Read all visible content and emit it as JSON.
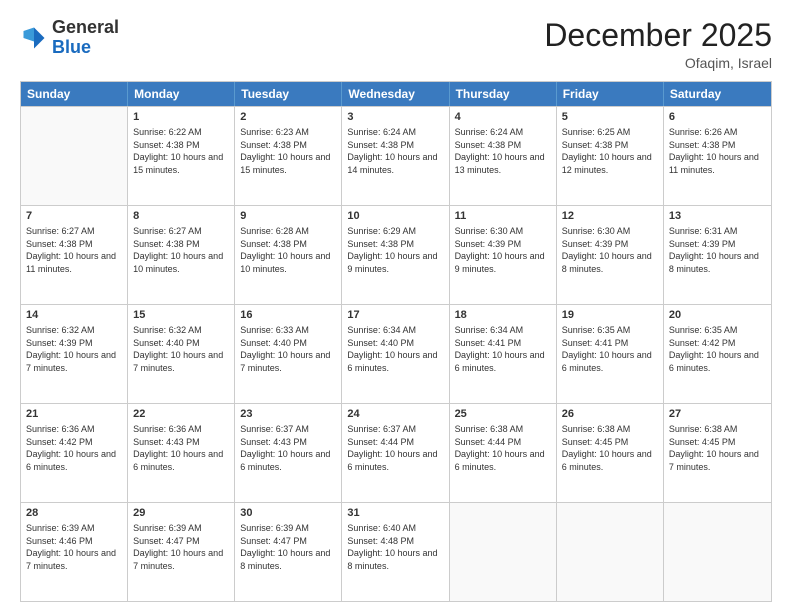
{
  "header": {
    "logo_general": "General",
    "logo_blue": "Blue",
    "month_year": "December 2025",
    "location": "Ofaqim, Israel"
  },
  "days_of_week": [
    "Sunday",
    "Monday",
    "Tuesday",
    "Wednesday",
    "Thursday",
    "Friday",
    "Saturday"
  ],
  "weeks": [
    [
      {
        "day": "",
        "empty": true
      },
      {
        "day": "1",
        "sunrise": "6:22 AM",
        "sunset": "4:38 PM",
        "daylight": "10 hours and 15 minutes."
      },
      {
        "day": "2",
        "sunrise": "6:23 AM",
        "sunset": "4:38 PM",
        "daylight": "10 hours and 15 minutes."
      },
      {
        "day": "3",
        "sunrise": "6:24 AM",
        "sunset": "4:38 PM",
        "daylight": "10 hours and 14 minutes."
      },
      {
        "day": "4",
        "sunrise": "6:24 AM",
        "sunset": "4:38 PM",
        "daylight": "10 hours and 13 minutes."
      },
      {
        "day": "5",
        "sunrise": "6:25 AM",
        "sunset": "4:38 PM",
        "daylight": "10 hours and 12 minutes."
      },
      {
        "day": "6",
        "sunrise": "6:26 AM",
        "sunset": "4:38 PM",
        "daylight": "10 hours and 11 minutes."
      }
    ],
    [
      {
        "day": "7",
        "sunrise": "6:27 AM",
        "sunset": "4:38 PM",
        "daylight": "10 hours and 11 minutes."
      },
      {
        "day": "8",
        "sunrise": "6:27 AM",
        "sunset": "4:38 PM",
        "daylight": "10 hours and 10 minutes."
      },
      {
        "day": "9",
        "sunrise": "6:28 AM",
        "sunset": "4:38 PM",
        "daylight": "10 hours and 10 minutes."
      },
      {
        "day": "10",
        "sunrise": "6:29 AM",
        "sunset": "4:38 PM",
        "daylight": "10 hours and 9 minutes."
      },
      {
        "day": "11",
        "sunrise": "6:30 AM",
        "sunset": "4:39 PM",
        "daylight": "10 hours and 9 minutes."
      },
      {
        "day": "12",
        "sunrise": "6:30 AM",
        "sunset": "4:39 PM",
        "daylight": "10 hours and 8 minutes."
      },
      {
        "day": "13",
        "sunrise": "6:31 AM",
        "sunset": "4:39 PM",
        "daylight": "10 hours and 8 minutes."
      }
    ],
    [
      {
        "day": "14",
        "sunrise": "6:32 AM",
        "sunset": "4:39 PM",
        "daylight": "10 hours and 7 minutes."
      },
      {
        "day": "15",
        "sunrise": "6:32 AM",
        "sunset": "4:40 PM",
        "daylight": "10 hours and 7 minutes."
      },
      {
        "day": "16",
        "sunrise": "6:33 AM",
        "sunset": "4:40 PM",
        "daylight": "10 hours and 7 minutes."
      },
      {
        "day": "17",
        "sunrise": "6:34 AM",
        "sunset": "4:40 PM",
        "daylight": "10 hours and 6 minutes."
      },
      {
        "day": "18",
        "sunrise": "6:34 AM",
        "sunset": "4:41 PM",
        "daylight": "10 hours and 6 minutes."
      },
      {
        "day": "19",
        "sunrise": "6:35 AM",
        "sunset": "4:41 PM",
        "daylight": "10 hours and 6 minutes."
      },
      {
        "day": "20",
        "sunrise": "6:35 AM",
        "sunset": "4:42 PM",
        "daylight": "10 hours and 6 minutes."
      }
    ],
    [
      {
        "day": "21",
        "sunrise": "6:36 AM",
        "sunset": "4:42 PM",
        "daylight": "10 hours and 6 minutes."
      },
      {
        "day": "22",
        "sunrise": "6:36 AM",
        "sunset": "4:43 PM",
        "daylight": "10 hours and 6 minutes."
      },
      {
        "day": "23",
        "sunrise": "6:37 AM",
        "sunset": "4:43 PM",
        "daylight": "10 hours and 6 minutes."
      },
      {
        "day": "24",
        "sunrise": "6:37 AM",
        "sunset": "4:44 PM",
        "daylight": "10 hours and 6 minutes."
      },
      {
        "day": "25",
        "sunrise": "6:38 AM",
        "sunset": "4:44 PM",
        "daylight": "10 hours and 6 minutes."
      },
      {
        "day": "26",
        "sunrise": "6:38 AM",
        "sunset": "4:45 PM",
        "daylight": "10 hours and 6 minutes."
      },
      {
        "day": "27",
        "sunrise": "6:38 AM",
        "sunset": "4:45 PM",
        "daylight": "10 hours and 7 minutes."
      }
    ],
    [
      {
        "day": "28",
        "sunrise": "6:39 AM",
        "sunset": "4:46 PM",
        "daylight": "10 hours and 7 minutes."
      },
      {
        "day": "29",
        "sunrise": "6:39 AM",
        "sunset": "4:47 PM",
        "daylight": "10 hours and 7 minutes."
      },
      {
        "day": "30",
        "sunrise": "6:39 AM",
        "sunset": "4:47 PM",
        "daylight": "10 hours and 8 minutes."
      },
      {
        "day": "31",
        "sunrise": "6:40 AM",
        "sunset": "4:48 PM",
        "daylight": "10 hours and 8 minutes."
      },
      {
        "day": "",
        "empty": true
      },
      {
        "day": "",
        "empty": true
      },
      {
        "day": "",
        "empty": true
      }
    ]
  ]
}
